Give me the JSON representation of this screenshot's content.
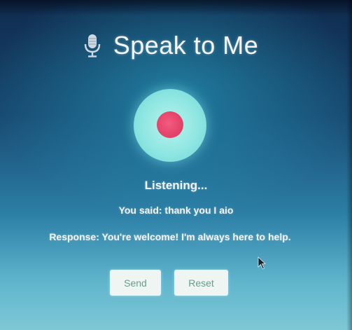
{
  "app": {
    "title": "Speak to Me"
  },
  "icons": {
    "title_icon": "microphone-icon",
    "record_icon": "record-dot-icon"
  },
  "colors": {
    "record_ring": "#8fe6e2",
    "record_dot": "#e23f66",
    "button_bg": "#eef5f3",
    "button_text": "#6a9b8c"
  },
  "conversation": {
    "status": "Listening...",
    "you_said": "You said: thank you I aio",
    "response": "Response: You're welcome! I'm always here to help."
  },
  "controls": {
    "send_label": "Send",
    "reset_label": "Reset"
  }
}
